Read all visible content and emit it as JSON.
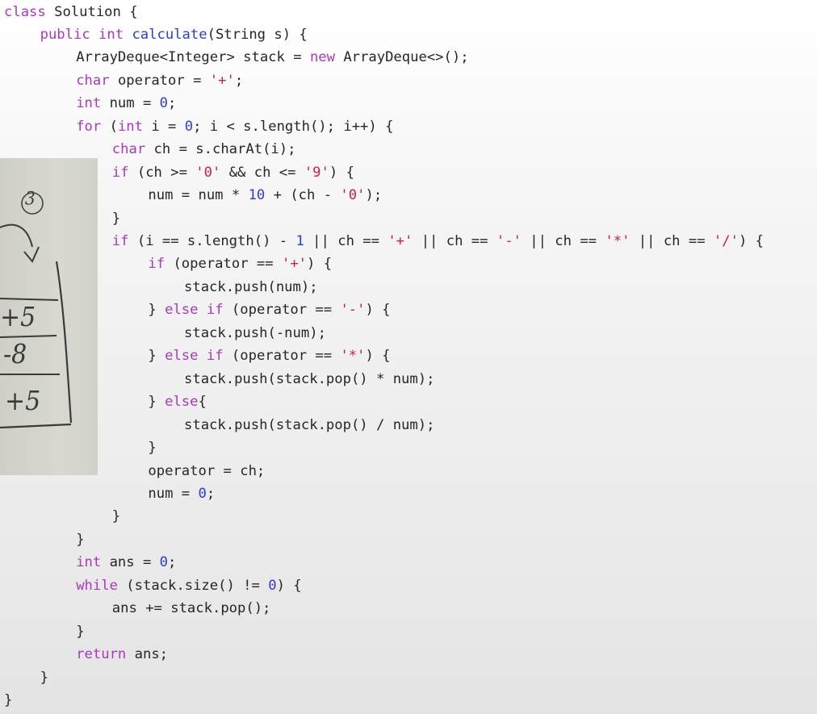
{
  "code_lines": [
    {
      "indent": 0,
      "tokens": [
        {
          "c": "kw",
          "t": "class"
        },
        {
          "t": " Solution {"
        }
      ]
    },
    {
      "indent": 1,
      "tokens": [
        {
          "c": "kw",
          "t": "public"
        },
        {
          "t": " "
        },
        {
          "c": "ty",
          "t": "int"
        },
        {
          "t": " "
        },
        {
          "c": "fn",
          "t": "calculate"
        },
        {
          "t": "(String s) {"
        }
      ]
    },
    {
      "indent": 2,
      "tokens": [
        {
          "t": "ArrayDeque<Integer> stack = "
        },
        {
          "c": "kw",
          "t": "new"
        },
        {
          "t": " ArrayDeque<>();"
        }
      ]
    },
    {
      "indent": 2,
      "tokens": [
        {
          "c": "ty",
          "t": "char"
        },
        {
          "t": " operator = "
        },
        {
          "c": "str",
          "t": "'+'"
        },
        {
          "t": ";"
        }
      ]
    },
    {
      "indent": 2,
      "tokens": [
        {
          "c": "ty",
          "t": "int"
        },
        {
          "t": " num = "
        },
        {
          "c": "num",
          "t": "0"
        },
        {
          "t": ";"
        }
      ]
    },
    {
      "indent": 2,
      "tokens": [
        {
          "c": "kw",
          "t": "for"
        },
        {
          "t": " ("
        },
        {
          "c": "ty",
          "t": "int"
        },
        {
          "t": " i = "
        },
        {
          "c": "num",
          "t": "0"
        },
        {
          "t": "; i < s.length(); i++) {"
        }
      ]
    },
    {
      "indent": 3,
      "tokens": [
        {
          "c": "ty",
          "t": "char"
        },
        {
          "t": " ch = s.charAt(i);"
        }
      ]
    },
    {
      "indent": 3,
      "tokens": [
        {
          "c": "kw",
          "t": "if"
        },
        {
          "t": " (ch >= "
        },
        {
          "c": "str",
          "t": "'0'"
        },
        {
          "t": " && ch <= "
        },
        {
          "c": "str",
          "t": "'9'"
        },
        {
          "t": ") {"
        }
      ]
    },
    {
      "indent": 4,
      "tokens": [
        {
          "t": "num = num * "
        },
        {
          "c": "num",
          "t": "10"
        },
        {
          "t": " + (ch - "
        },
        {
          "c": "str",
          "t": "'0'"
        },
        {
          "t": ");"
        }
      ]
    },
    {
      "indent": 3,
      "tokens": [
        {
          "t": "}"
        }
      ]
    },
    {
      "indent": 3,
      "tokens": [
        {
          "c": "kw",
          "t": "if"
        },
        {
          "t": " (i == s.length() - "
        },
        {
          "c": "num",
          "t": "1"
        },
        {
          "t": " || ch == "
        },
        {
          "c": "str",
          "t": "'+'"
        },
        {
          "t": " || ch == "
        },
        {
          "c": "str",
          "t": "'-'"
        },
        {
          "t": " || ch == "
        },
        {
          "c": "str",
          "t": "'*'"
        },
        {
          "t": " || ch == "
        },
        {
          "c": "str",
          "t": "'/'"
        },
        {
          "t": ") {"
        }
      ]
    },
    {
      "indent": 4,
      "tokens": [
        {
          "c": "kw",
          "t": "if"
        },
        {
          "t": " (operator == "
        },
        {
          "c": "str",
          "t": "'+'"
        },
        {
          "t": ") {"
        }
      ]
    },
    {
      "indent": 5,
      "tokens": [
        {
          "t": "stack.push(num);"
        }
      ]
    },
    {
      "indent": 4,
      "tokens": [
        {
          "t": "} "
        },
        {
          "c": "kw",
          "t": "else"
        },
        {
          "t": " "
        },
        {
          "c": "kw",
          "t": "if"
        },
        {
          "t": " (operator == "
        },
        {
          "c": "str",
          "t": "'-'"
        },
        {
          "t": ") {"
        }
      ]
    },
    {
      "indent": 5,
      "tokens": [
        {
          "t": "stack.push(-num);"
        }
      ]
    },
    {
      "indent": 4,
      "tokens": [
        {
          "t": "} "
        },
        {
          "c": "kw",
          "t": "else"
        },
        {
          "t": " "
        },
        {
          "c": "kw",
          "t": "if"
        },
        {
          "t": " (operator == "
        },
        {
          "c": "str",
          "t": "'*'"
        },
        {
          "t": ") {"
        }
      ]
    },
    {
      "indent": 5,
      "tokens": [
        {
          "t": "stack.push(stack.pop() * num);"
        }
      ]
    },
    {
      "indent": 4,
      "tokens": [
        {
          "t": "} "
        },
        {
          "c": "kw",
          "t": "else"
        },
        {
          "t": "{"
        }
      ]
    },
    {
      "indent": 5,
      "tokens": [
        {
          "t": "stack.push(stack.pop() / num);"
        }
      ]
    },
    {
      "indent": 4,
      "tokens": [
        {
          "t": "}"
        }
      ]
    },
    {
      "indent": 4,
      "tokens": [
        {
          "t": "operator = ch;"
        }
      ]
    },
    {
      "indent": 4,
      "tokens": [
        {
          "t": "num = "
        },
        {
          "c": "num",
          "t": "0"
        },
        {
          "t": ";"
        }
      ]
    },
    {
      "indent": 3,
      "tokens": [
        {
          "t": "}"
        }
      ]
    },
    {
      "indent": 2,
      "tokens": [
        {
          "t": "}"
        }
      ]
    },
    {
      "indent": 2,
      "tokens": [
        {
          "c": "ty",
          "t": "int"
        },
        {
          "t": " ans = "
        },
        {
          "c": "num",
          "t": "0"
        },
        {
          "t": ";"
        }
      ]
    },
    {
      "indent": 2,
      "tokens": [
        {
          "c": "kw",
          "t": "while"
        },
        {
          "t": " (stack.size() != "
        },
        {
          "c": "num",
          "t": "0"
        },
        {
          "t": ") {"
        }
      ]
    },
    {
      "indent": 3,
      "tokens": [
        {
          "t": "ans += stack.pop();"
        }
      ]
    },
    {
      "indent": 2,
      "tokens": [
        {
          "t": "}"
        }
      ]
    },
    {
      "indent": 2,
      "tokens": [
        {
          "c": "kw",
          "t": "return"
        },
        {
          "t": " ans;"
        }
      ]
    },
    {
      "indent": 1,
      "tokens": [
        {
          "t": "}"
        }
      ]
    },
    {
      "indent": 0,
      "tokens": [
        {
          "t": "}"
        }
      ]
    }
  ],
  "handwritten_note": {
    "step_marker": "3",
    "stack_entries": [
      "+5",
      "-8",
      "+5"
    ]
  },
  "colors": {
    "keyword": "#a73ab8",
    "method": "#2f3fbf",
    "number": "#2d3cd6",
    "string": "#c8223a",
    "text": "#262626"
  }
}
